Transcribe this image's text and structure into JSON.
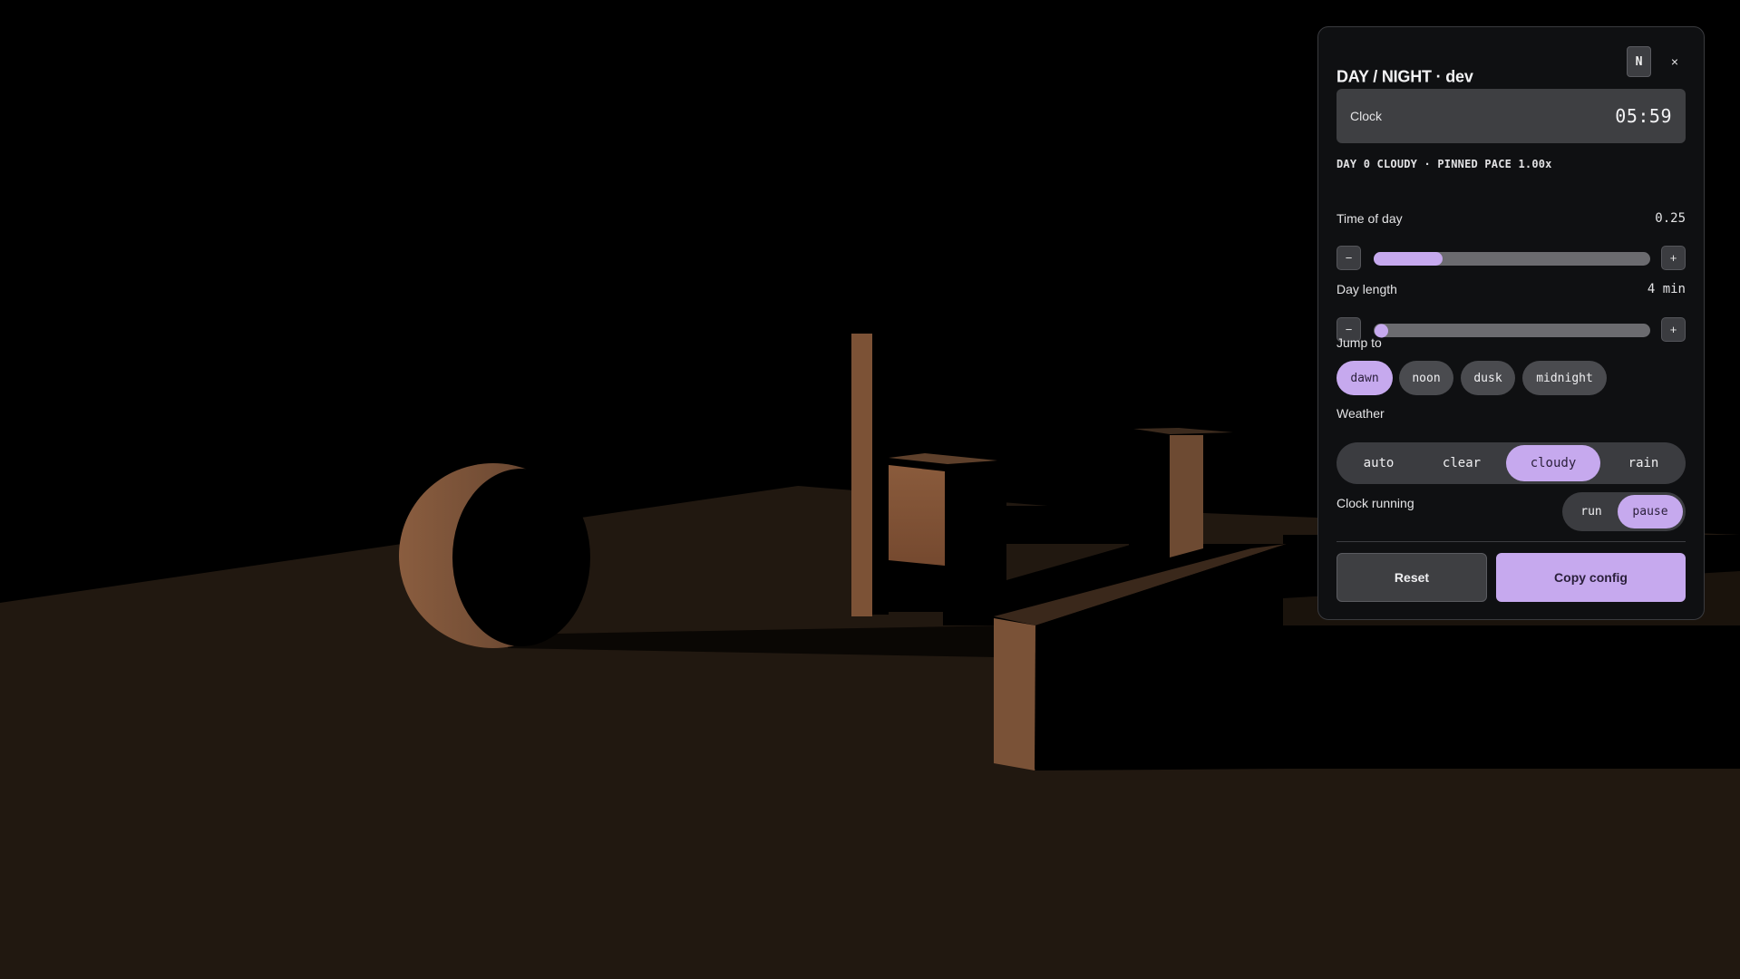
{
  "panel": {
    "title": "DAY / NIGHT · dev",
    "badge": "N",
    "close_glyph": "×",
    "clock": {
      "label": "Clock",
      "value": "05:59"
    },
    "status": "DAY 0 CLOUDY · PINNED PACE 1.00x",
    "time_of_day": {
      "label": "Time of day",
      "value": "0.25",
      "level": 0.25,
      "minus": "−",
      "plus": "+"
    },
    "day_length": {
      "label": "Day length",
      "value": "4 min",
      "level": 0.025,
      "minus": "−",
      "plus": "+"
    },
    "jump_to": {
      "label": "Jump to",
      "options": [
        "dawn",
        "noon",
        "dusk",
        "midnight"
      ],
      "active": "dawn"
    },
    "weather": {
      "label": "Weather",
      "options": [
        "auto",
        "clear",
        "cloudy",
        "rain"
      ],
      "active": "cloudy"
    },
    "clock_running": {
      "label": "Clock running",
      "options": [
        "run",
        "pause"
      ],
      "active": "pause"
    },
    "actions": {
      "reset": "Reset",
      "copy": "Copy config"
    }
  },
  "colors": {
    "accent": "#c6a9ee",
    "panel_bg": "#0f1012",
    "ground": "#211810",
    "lit_face": "#7a5238"
  },
  "icons": {
    "close": "close-icon"
  }
}
